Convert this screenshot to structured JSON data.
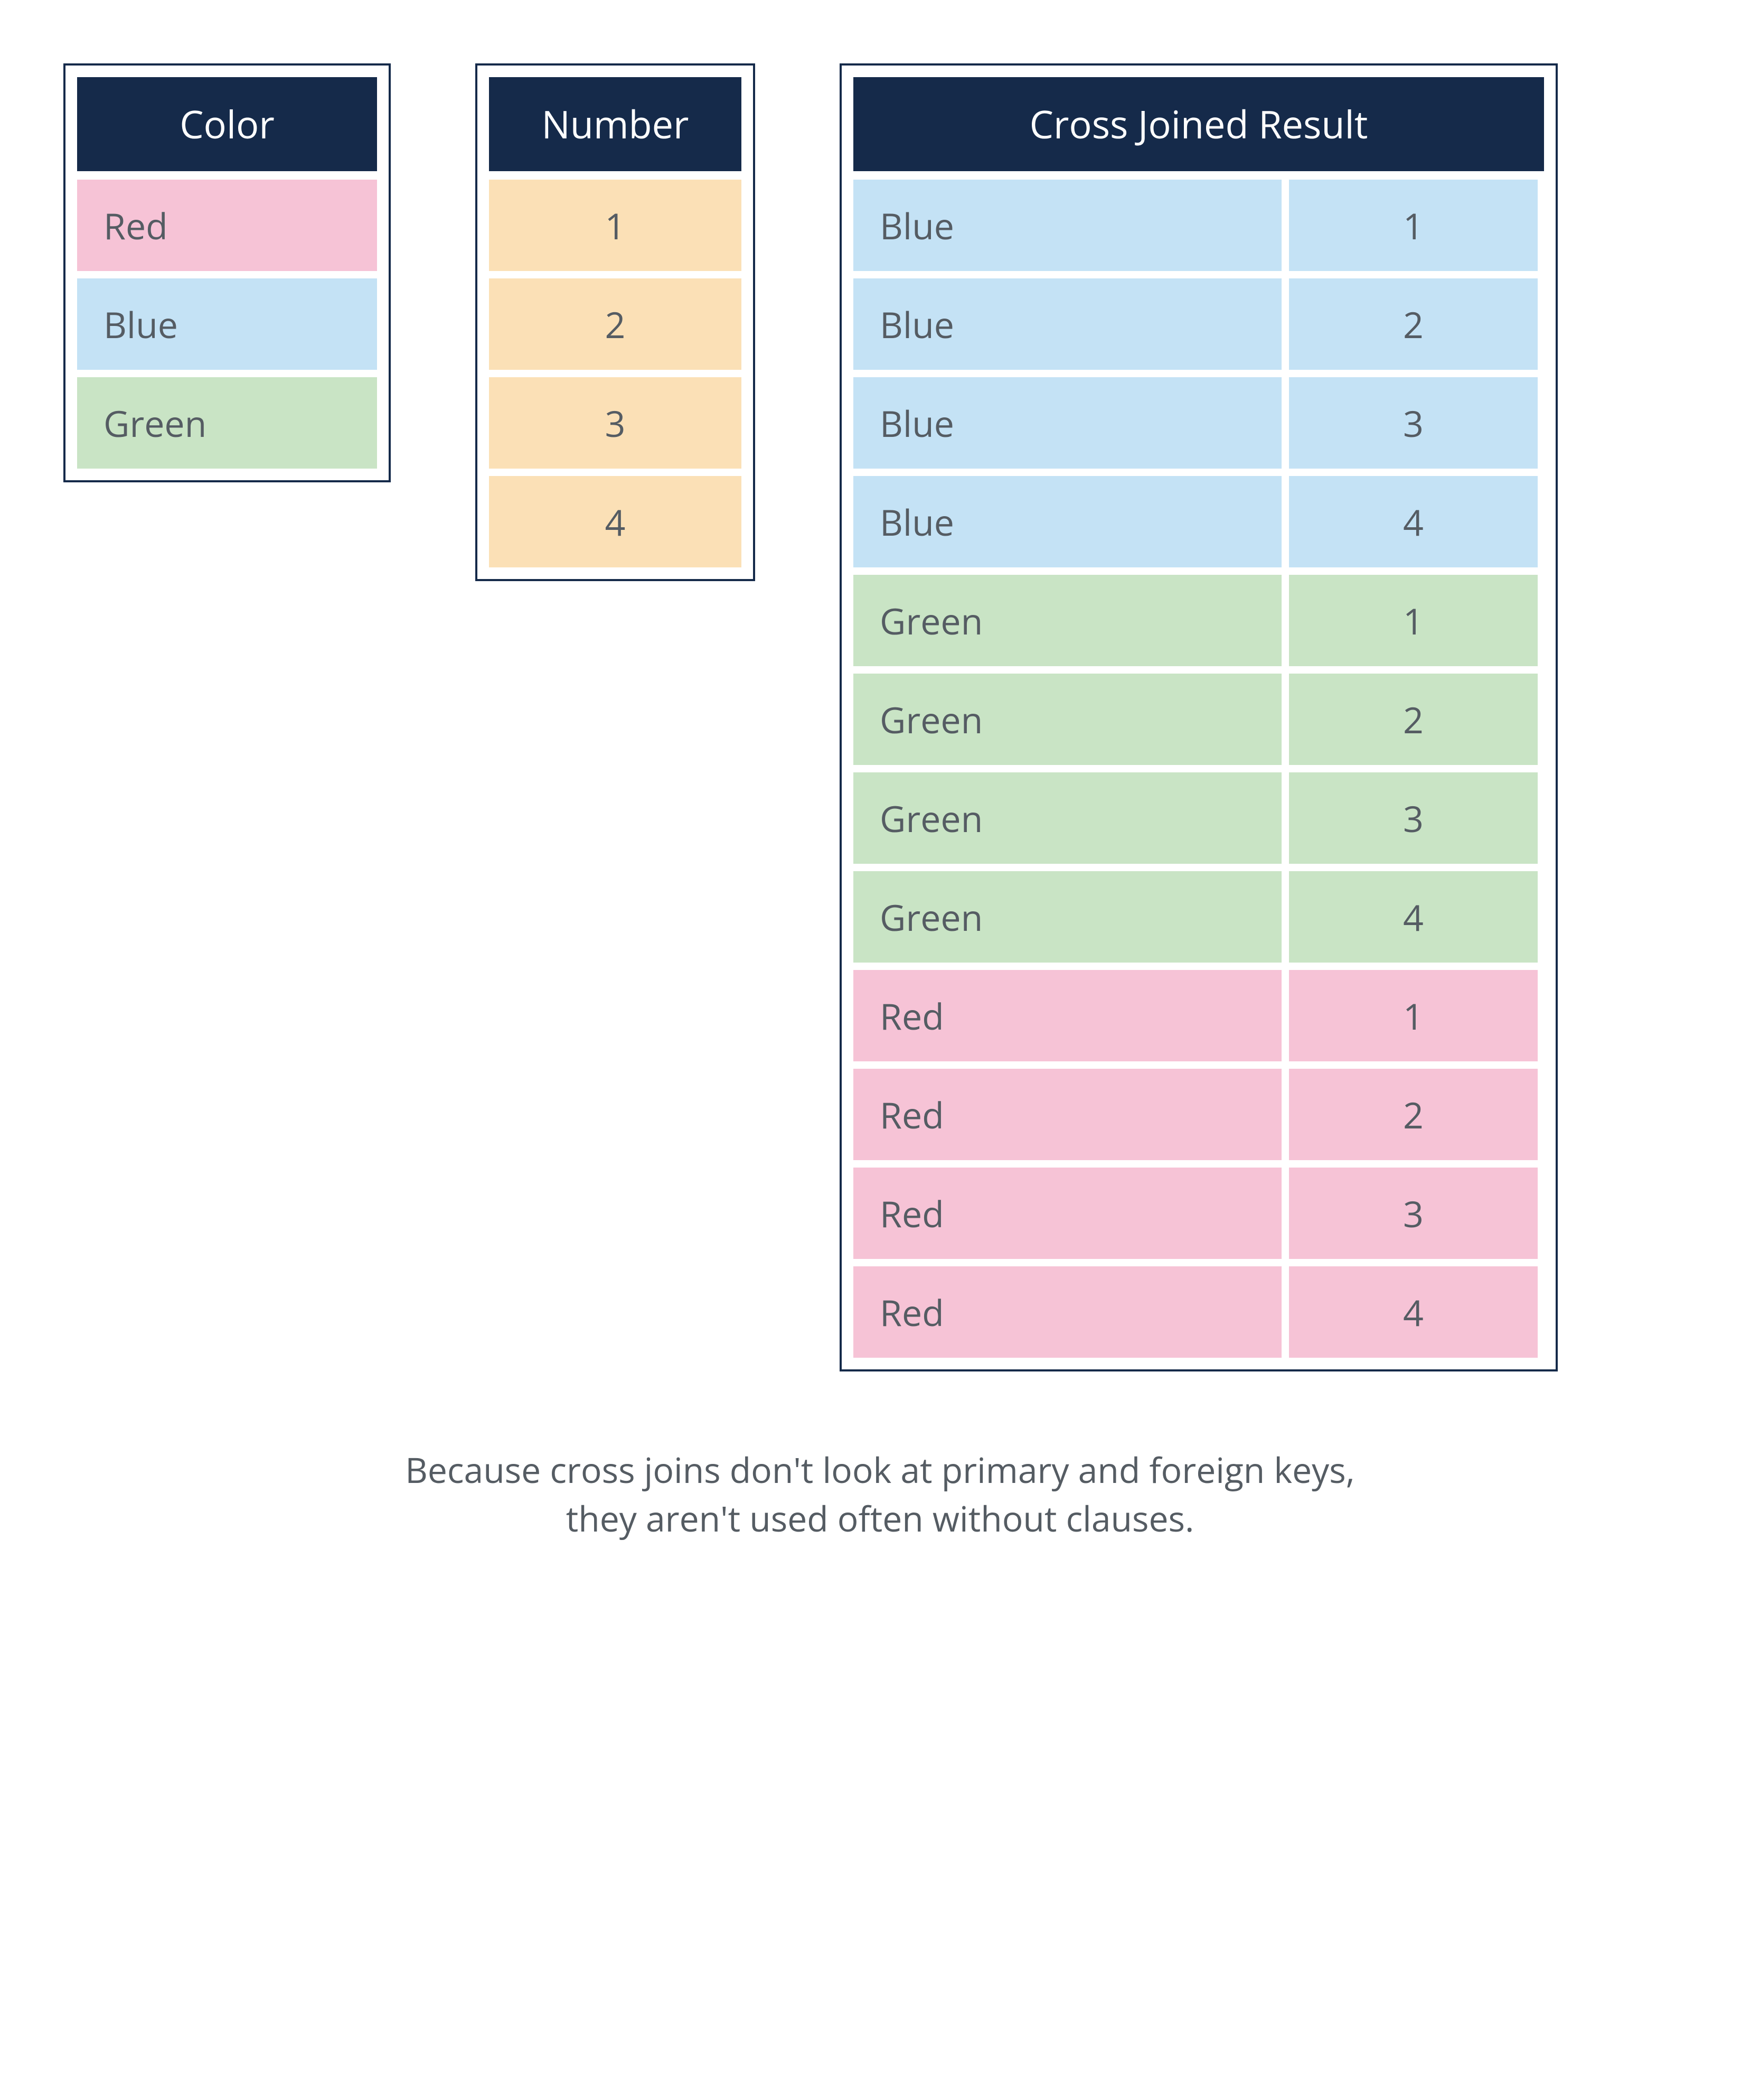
{
  "palette": {
    "Red": "#f6c3d6",
    "Blue": "#c4e2f5",
    "Green": "#c9e4c5",
    "Number": "#fbe0b6"
  },
  "color_table": {
    "header": "Color",
    "rows": [
      "Red",
      "Blue",
      "Green"
    ]
  },
  "number_table": {
    "header": "Number",
    "rows": [
      "1",
      "2",
      "3",
      "4"
    ]
  },
  "result_table": {
    "header": "Cross Joined Result",
    "rows": [
      {
        "color": "Blue",
        "number": "1"
      },
      {
        "color": "Blue",
        "number": "2"
      },
      {
        "color": "Blue",
        "number": "3"
      },
      {
        "color": "Blue",
        "number": "4"
      },
      {
        "color": "Green",
        "number": "1"
      },
      {
        "color": "Green",
        "number": "2"
      },
      {
        "color": "Green",
        "number": "3"
      },
      {
        "color": "Green",
        "number": "4"
      },
      {
        "color": "Red",
        "number": "1"
      },
      {
        "color": "Red",
        "number": "2"
      },
      {
        "color": "Red",
        "number": "3"
      },
      {
        "color": "Red",
        "number": "4"
      }
    ]
  },
  "caption_line1": "Because cross joins don't look at primary and foreign keys,",
  "caption_line2": "they aren't used often without clauses."
}
